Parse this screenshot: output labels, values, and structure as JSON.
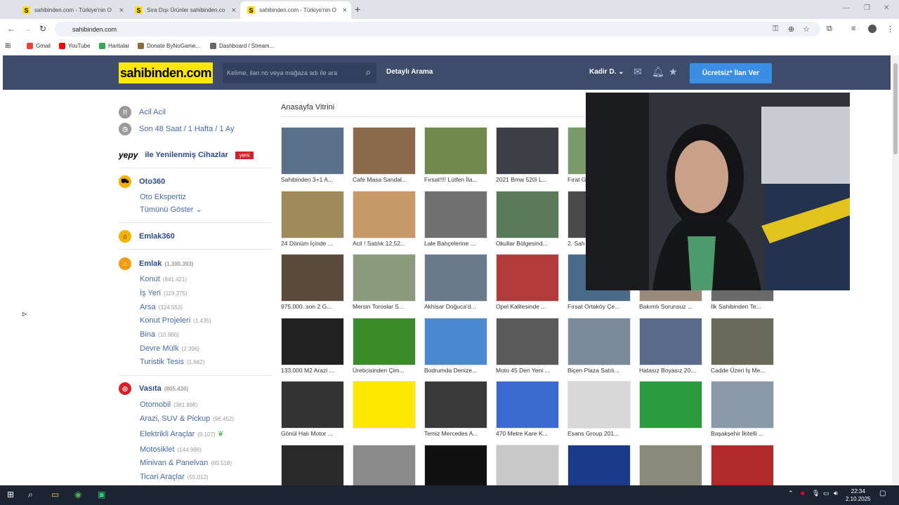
{
  "browser": {
    "tabs": [
      {
        "label": "sahibinden.com - Türkiye'nin O",
        "active": false
      },
      {
        "label": "Sıra Dışı Ürünler sahibinden.co",
        "active": false
      },
      {
        "label": "sahibinden.com - Türkiye'nin O",
        "active": true
      }
    ],
    "url": "sahibinden.com",
    "bookmarks": [
      "Gmail",
      "YouTube",
      "Haritalar",
      "Donate ByNoGame...",
      "Dashboard / Stream..."
    ]
  },
  "header": {
    "logo": "sahibinden.com",
    "search_placeholder": "Kelime, ilan no veya mağaza adı ile ara",
    "detailed_search": "Detaylı Arama",
    "user": "Kadir D.",
    "cta": "Ücretsiz* İlan Ver"
  },
  "sidebar": {
    "acil": "Acil Acil",
    "recent": "Son 48 Saat / 1 Hafta / 1 Ay",
    "yepy_brand": "yepy",
    "yepy_text": "ile Yenilenmiş Cihazlar",
    "yepy_badge": "yeni",
    "oto360": "Oto360",
    "oto_eksper": "Oto Ekspertiz",
    "show_all": "Tümünü Göster",
    "emlak360": "Emlak360",
    "emlak": {
      "label": "Emlak",
      "count": "(1.300.393)",
      "items": [
        {
          "label": "Konut",
          "count": "(841.421)"
        },
        {
          "label": "İş Yeri",
          "count": "(119.375)"
        },
        {
          "label": "Arsa",
          "count": "(324.553)"
        },
        {
          "label": "Konut Projeleri",
          "count": "(1.435)"
        },
        {
          "label": "Bina",
          "count": "(10.986)"
        },
        {
          "label": "Devre Mülk",
          "count": "(2.396)"
        },
        {
          "label": "Turistik Tesis",
          "count": "(1.662)"
        }
      ]
    },
    "vasita": {
      "label": "Vasıta",
      "count": "(805.436)",
      "items": [
        {
          "label": "Otomobil",
          "count": "(381.998)"
        },
        {
          "label": "Arazi, SUV & Pickup",
          "count": "(96.452)"
        },
        {
          "label": "Elektrikli Araçlar",
          "count": "(9.107)"
        },
        {
          "label": "Motosiklet",
          "count": "(144.986)"
        },
        {
          "label": "Minivan & Panelvan",
          "count": "(80.518)"
        },
        {
          "label": "Ticari Araçlar",
          "count": "(55.012)"
        }
      ]
    }
  },
  "showcase": {
    "title": "Anasayfa Vitrini",
    "items": [
      "Sahibinden 3+1 A...",
      "Cafe Masa Sandal...",
      "Fırsat!!!! Lütfen İla...",
      "2021 Bmw 520i L...",
      "Fırat G",
      "24 Dönüm İçinde ...",
      "Acil ! Satılık 12.52...",
      "Lale Bahçelerine ...",
      "Okullar Bölgesind...",
      "2. Sah",
      "975.000..son 2 G...",
      "Mersin Toroslar S...",
      "Akhisar Doğuca'd...",
      "Opel Kalitesinde ...",
      "Fırsat Ortaköy Çe...",
      "Bakımlı Sorunsuz ...",
      "İlk Sahibinden Te...",
      "133.000 M2 Arazi ...",
      "Üreticisinden Çim...",
      "Bodrumda Denize...",
      "Moto 45 Den Yeni ...",
      "Biçen Plaza Satılı...",
      "Hatasız Boyasız 20...",
      "Cadde Üzeri İş Me...",
      "Gönül Halı Motor ...",
      "",
      "Temiz Mercedes A...",
      "470 Metre Kare K...",
      "Esans Group 201...",
      "",
      "Başakşehir İkitelli ...",
      "",
      "",
      "",
      "",
      "",
      "",
      ""
    ]
  },
  "taskbar": {
    "time": "22:34",
    "date": "2.10.2025"
  }
}
